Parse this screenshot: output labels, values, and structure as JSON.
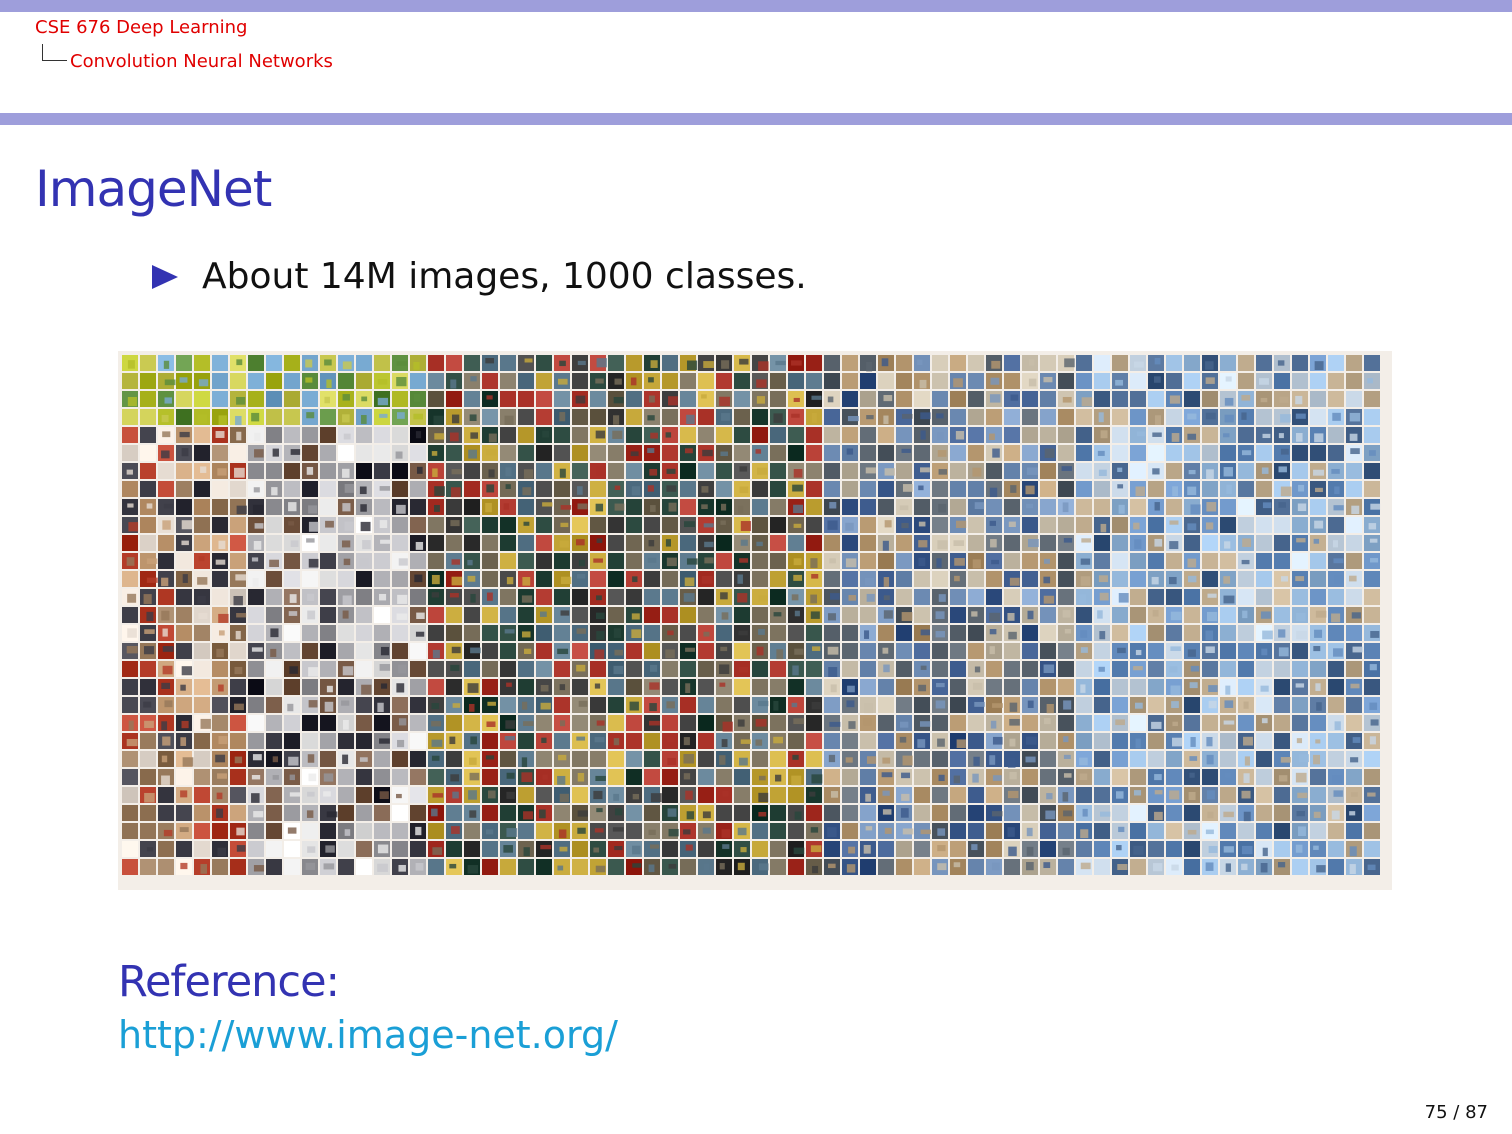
{
  "header": {
    "course": "CSE 676 Deep Learning",
    "section": "Convolution Neural Networks"
  },
  "slide": {
    "title": "ImageNet",
    "bullets": [
      "About 14M images, 1000 classes."
    ],
    "reference_label": "Reference:",
    "reference_link": "http://www.image-net.org/"
  },
  "footer": {
    "page": "75 / 87"
  },
  "image": {
    "description_icon": "imagenet-mosaic"
  },
  "colors": {
    "accent": "#3333b2",
    "bar": "#9e9edb",
    "crumb": "#e00000",
    "link": "#1a9fd6"
  }
}
